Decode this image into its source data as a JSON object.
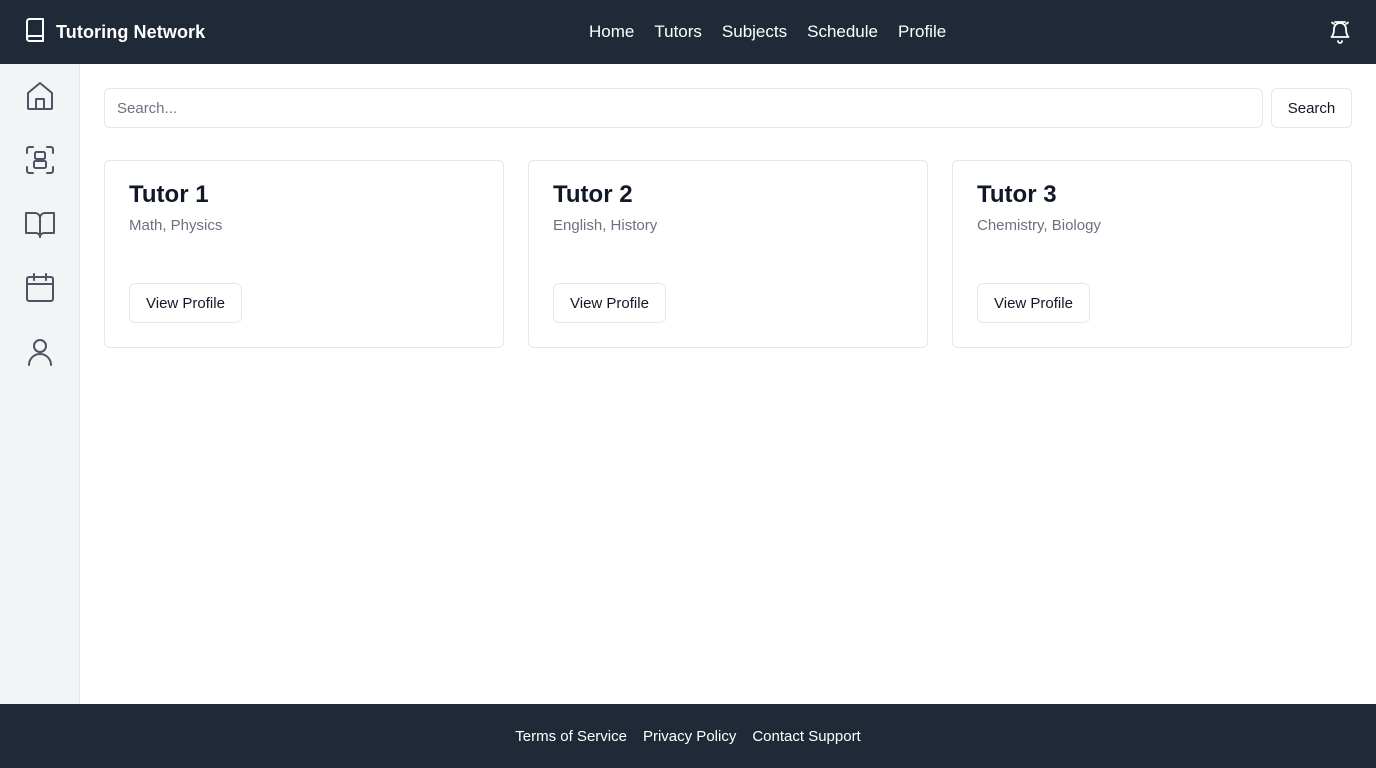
{
  "header": {
    "brand_icon": "book-icon",
    "title": "Tutoring Network",
    "nav": [
      {
        "label": "Home"
      },
      {
        "label": "Tutors"
      },
      {
        "label": "Subjects"
      },
      {
        "label": "Schedule"
      },
      {
        "label": "Profile"
      }
    ],
    "notification_icon": "bell-icon"
  },
  "sidebar": {
    "items": [
      {
        "icon": "home-icon"
      },
      {
        "icon": "tutors-icon"
      },
      {
        "icon": "book-open-icon"
      },
      {
        "icon": "calendar-icon"
      },
      {
        "icon": "user-icon"
      }
    ]
  },
  "search": {
    "placeholder": "Search...",
    "value": "",
    "button_label": "Search"
  },
  "tutors": [
    {
      "name": "Tutor 1",
      "subjects": "Math, Physics",
      "button_label": "View Profile"
    },
    {
      "name": "Tutor 2",
      "subjects": "English, History",
      "button_label": "View Profile"
    },
    {
      "name": "Tutor 3",
      "subjects": "Chemistry, Biology",
      "button_label": "View Profile"
    }
  ],
  "footer": {
    "links": [
      {
        "label": "Terms of Service"
      },
      {
        "label": "Privacy Policy"
      },
      {
        "label": "Contact Support"
      }
    ]
  },
  "colors": {
    "header_bg": "#1f2937",
    "sidebar_bg": "#f3f4f6",
    "border": "#e5e7eb",
    "muted_text": "#6b7280",
    "icon_gray": "#4b5563"
  }
}
